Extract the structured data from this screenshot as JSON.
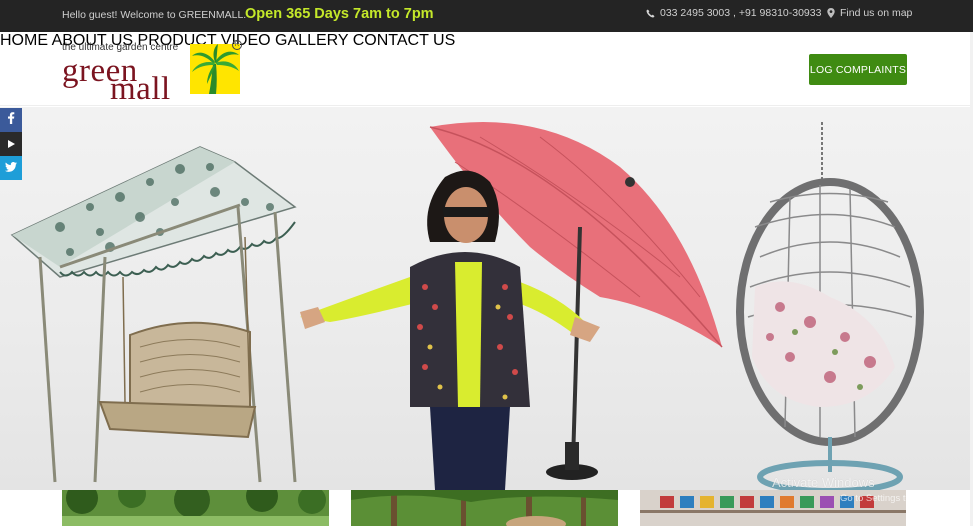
{
  "topbar": {
    "welcome": "Hello guest! Welcome to GREENMALL.",
    "hours": "Open 365 Days 7am to 7pm",
    "phone": "033 2495 3003 , +91 98310-30933",
    "map_link": "Find us on map"
  },
  "logo": {
    "tagline": "the ultimate garden centre",
    "word1": "green",
    "word2": "mall",
    "registered": "R"
  },
  "nav": {
    "items": [
      {
        "label": "HOME"
      },
      {
        "label": "ABOUT US"
      },
      {
        "label": "PRODUCT"
      },
      {
        "label": "VIDEO"
      },
      {
        "label": "GALLERY"
      },
      {
        "label": "CONTACT US"
      }
    ],
    "cta": "LOG COMPLAINTS"
  },
  "social": [
    "facebook-icon",
    "youtube-icon",
    "twitter-icon"
  ],
  "watermark": {
    "line1": "Activate Windows",
    "line2": "Go to Settings to activate Windows."
  },
  "colors": {
    "topbar_bg": "#242424",
    "hours_accent": "#c4e82a",
    "nav_green": "#5a9c3a",
    "button_green": "#3f8b12",
    "logo_maroon": "#7b1420",
    "logo_yellow": "#ffe500"
  }
}
